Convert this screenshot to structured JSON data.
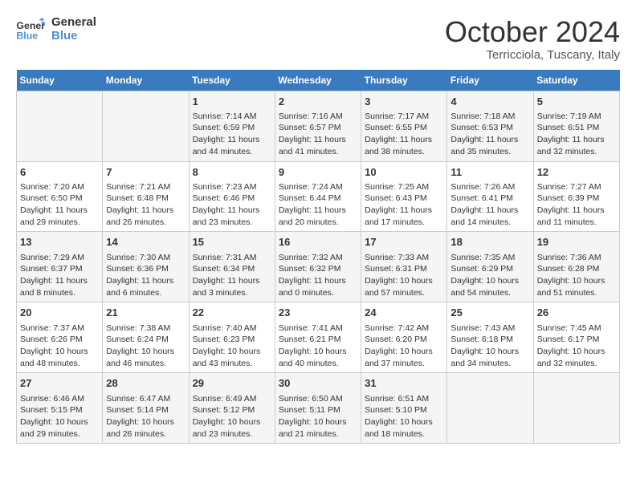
{
  "header": {
    "logo_line1": "General",
    "logo_line2": "Blue",
    "month": "October 2024",
    "location": "Terricciola, Tuscany, Italy"
  },
  "days_of_week": [
    "Sunday",
    "Monday",
    "Tuesday",
    "Wednesday",
    "Thursday",
    "Friday",
    "Saturday"
  ],
  "weeks": [
    [
      {
        "day": "",
        "info": ""
      },
      {
        "day": "",
        "info": ""
      },
      {
        "day": "1",
        "info": "Sunrise: 7:14 AM\nSunset: 6:59 PM\nDaylight: 11 hours and 44 minutes."
      },
      {
        "day": "2",
        "info": "Sunrise: 7:16 AM\nSunset: 6:57 PM\nDaylight: 11 hours and 41 minutes."
      },
      {
        "day": "3",
        "info": "Sunrise: 7:17 AM\nSunset: 6:55 PM\nDaylight: 11 hours and 38 minutes."
      },
      {
        "day": "4",
        "info": "Sunrise: 7:18 AM\nSunset: 6:53 PM\nDaylight: 11 hours and 35 minutes."
      },
      {
        "day": "5",
        "info": "Sunrise: 7:19 AM\nSunset: 6:51 PM\nDaylight: 11 hours and 32 minutes."
      }
    ],
    [
      {
        "day": "6",
        "info": "Sunrise: 7:20 AM\nSunset: 6:50 PM\nDaylight: 11 hours and 29 minutes."
      },
      {
        "day": "7",
        "info": "Sunrise: 7:21 AM\nSunset: 6:48 PM\nDaylight: 11 hours and 26 minutes."
      },
      {
        "day": "8",
        "info": "Sunrise: 7:23 AM\nSunset: 6:46 PM\nDaylight: 11 hours and 23 minutes."
      },
      {
        "day": "9",
        "info": "Sunrise: 7:24 AM\nSunset: 6:44 PM\nDaylight: 11 hours and 20 minutes."
      },
      {
        "day": "10",
        "info": "Sunrise: 7:25 AM\nSunset: 6:43 PM\nDaylight: 11 hours and 17 minutes."
      },
      {
        "day": "11",
        "info": "Sunrise: 7:26 AM\nSunset: 6:41 PM\nDaylight: 11 hours and 14 minutes."
      },
      {
        "day": "12",
        "info": "Sunrise: 7:27 AM\nSunset: 6:39 PM\nDaylight: 11 hours and 11 minutes."
      }
    ],
    [
      {
        "day": "13",
        "info": "Sunrise: 7:29 AM\nSunset: 6:37 PM\nDaylight: 11 hours and 8 minutes."
      },
      {
        "day": "14",
        "info": "Sunrise: 7:30 AM\nSunset: 6:36 PM\nDaylight: 11 hours and 6 minutes."
      },
      {
        "day": "15",
        "info": "Sunrise: 7:31 AM\nSunset: 6:34 PM\nDaylight: 11 hours and 3 minutes."
      },
      {
        "day": "16",
        "info": "Sunrise: 7:32 AM\nSunset: 6:32 PM\nDaylight: 11 hours and 0 minutes."
      },
      {
        "day": "17",
        "info": "Sunrise: 7:33 AM\nSunset: 6:31 PM\nDaylight: 10 hours and 57 minutes."
      },
      {
        "day": "18",
        "info": "Sunrise: 7:35 AM\nSunset: 6:29 PM\nDaylight: 10 hours and 54 minutes."
      },
      {
        "day": "19",
        "info": "Sunrise: 7:36 AM\nSunset: 6:28 PM\nDaylight: 10 hours and 51 minutes."
      }
    ],
    [
      {
        "day": "20",
        "info": "Sunrise: 7:37 AM\nSunset: 6:26 PM\nDaylight: 10 hours and 48 minutes."
      },
      {
        "day": "21",
        "info": "Sunrise: 7:38 AM\nSunset: 6:24 PM\nDaylight: 10 hours and 46 minutes."
      },
      {
        "day": "22",
        "info": "Sunrise: 7:40 AM\nSunset: 6:23 PM\nDaylight: 10 hours and 43 minutes."
      },
      {
        "day": "23",
        "info": "Sunrise: 7:41 AM\nSunset: 6:21 PM\nDaylight: 10 hours and 40 minutes."
      },
      {
        "day": "24",
        "info": "Sunrise: 7:42 AM\nSunset: 6:20 PM\nDaylight: 10 hours and 37 minutes."
      },
      {
        "day": "25",
        "info": "Sunrise: 7:43 AM\nSunset: 6:18 PM\nDaylight: 10 hours and 34 minutes."
      },
      {
        "day": "26",
        "info": "Sunrise: 7:45 AM\nSunset: 6:17 PM\nDaylight: 10 hours and 32 minutes."
      }
    ],
    [
      {
        "day": "27",
        "info": "Sunrise: 6:46 AM\nSunset: 5:15 PM\nDaylight: 10 hours and 29 minutes."
      },
      {
        "day": "28",
        "info": "Sunrise: 6:47 AM\nSunset: 5:14 PM\nDaylight: 10 hours and 26 minutes."
      },
      {
        "day": "29",
        "info": "Sunrise: 6:49 AM\nSunset: 5:12 PM\nDaylight: 10 hours and 23 minutes."
      },
      {
        "day": "30",
        "info": "Sunrise: 6:50 AM\nSunset: 5:11 PM\nDaylight: 10 hours and 21 minutes."
      },
      {
        "day": "31",
        "info": "Sunrise: 6:51 AM\nSunset: 5:10 PM\nDaylight: 10 hours and 18 minutes."
      },
      {
        "day": "",
        "info": ""
      },
      {
        "day": "",
        "info": ""
      }
    ]
  ]
}
